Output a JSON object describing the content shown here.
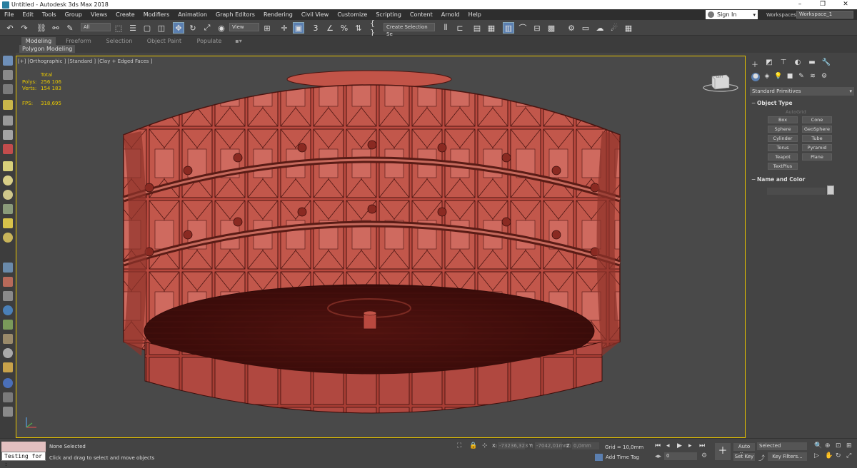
{
  "window": {
    "title": "Untitled - Autodesk 3ds Max 2018",
    "controls": [
      "–",
      "❐",
      "✕"
    ]
  },
  "menu": [
    "File",
    "Edit",
    "Tools",
    "Group",
    "Views",
    "Create",
    "Modifiers",
    "Animation",
    "Graph Editors",
    "Rendering",
    "Civil View",
    "Customize",
    "Scripting",
    "Content",
    "Arnold",
    "Help"
  ],
  "account": {
    "sign_in": "Sign In",
    "workspaces_label": "Workspaces:",
    "workspace": "Workspace_1"
  },
  "toolbar": {
    "filter": "All",
    "view": "View",
    "snap_label": "3",
    "selection_set": "Create Selection Se"
  },
  "ribbon": {
    "tabs": [
      "Modeling",
      "Freeform",
      "Selection",
      "Object Paint",
      "Populate"
    ],
    "active_tab": "Modeling",
    "sub": "Polygon Modeling"
  },
  "viewport": {
    "label": "[+] [Orthographic ] [Standard ] [Clay + Edged Faces ]",
    "stats": {
      "total": "Total",
      "polys_label": "Polys:",
      "polys": "256 106",
      "verts_label": "Verts:",
      "verts": "154 183",
      "fps_label": "FPS:",
      "fps": "318,695"
    },
    "viewcube": "LEFT",
    "accent_color": "#e8c400",
    "model_color": "#b9493f"
  },
  "command_panel": {
    "category": "Standard Primitives",
    "object_type": "Object Type",
    "autogrid": "AutoGrid",
    "objects": [
      "Box",
      "Cone",
      "Sphere",
      "GeoSphere",
      "Cylinder",
      "Tube",
      "Torus",
      "Pyramid",
      "Teapot",
      "Plane",
      "TextPlus"
    ],
    "name_and_color": "Name and Color"
  },
  "status": {
    "selection": "None Selected",
    "prompt": "Click and drag to select and move objects",
    "script_input": "Testing for :",
    "x_label": "X:",
    "x": "-73236,323",
    "y_label": "Y:",
    "y": "-7042,01mm",
    "z_label": "Z:",
    "z": "0,0mm",
    "grid": "Grid = 10,0mm",
    "add_time_tag": "Add Time Tag",
    "frame": "0",
    "auto_key": "Auto Key",
    "set_key": "Set Key",
    "selected": "Selected",
    "key_filters": "Key Filters..."
  }
}
